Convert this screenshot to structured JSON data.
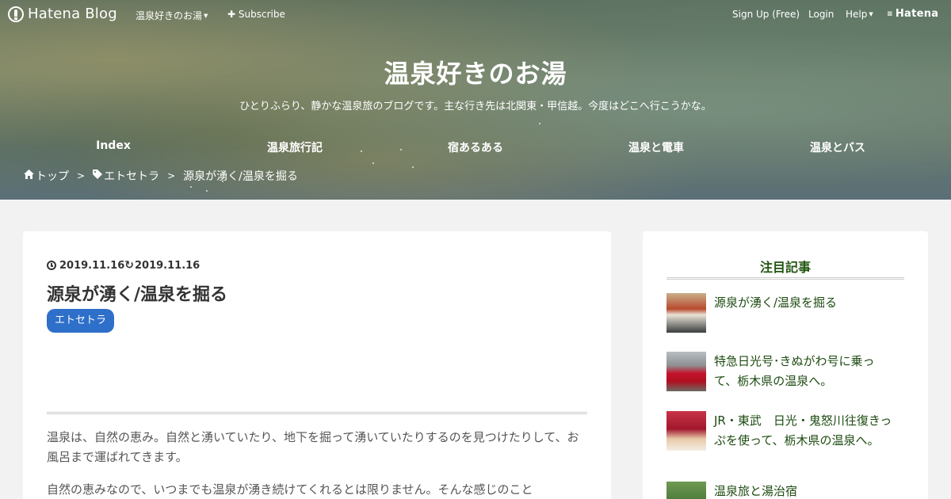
{
  "topbar": {
    "logo_text": "Hatena Blog",
    "blog_menu": "温泉好きのお湯",
    "subscribe": "Subscribe",
    "signup": "Sign Up (Free)",
    "login": "Login",
    "help": "Help",
    "hatena": "Hatena"
  },
  "header": {
    "title": "温泉好きのお湯",
    "description": "ひとりふらり、静かな温泉旅のブログです。主な行き先は北関東・甲信越。今度はどこへ行こうかな。"
  },
  "nav": {
    "items": [
      "Index",
      "温泉旅行記",
      "宿あるある",
      "温泉と電車",
      "温泉とバス"
    ]
  },
  "breadcrumb": {
    "home": "トップ",
    "category": "エトセトラ",
    "current": "源泉が湧く/温泉を掘る",
    "separator": ">"
  },
  "post": {
    "published": "2019.11.16",
    "updated": "2019.11.16",
    "title": "源泉が湧く/温泉を掘る",
    "tag": "エトセトラ",
    "paragraphs": [
      "温泉は、自然の恵み。自然と湧いていたり、地下を掘って湧いていたりするのを見つけたりして、お風呂まで運ばれてきます。",
      "自然の恵みなので、いつまでも温泉が湧き続けてくれるとは限りません。そんな感じのこと"
    ]
  },
  "sidebar": {
    "heading": "注目記事",
    "articles": [
      {
        "title": "源泉が湧く/温泉を掘る"
      },
      {
        "title": "特急日光号･きぬがわ号に乗って、栃木県の温泉へ。"
      },
      {
        "title": "JR・東武　日光・鬼怒川往復きっぷを使って、栃木県の温泉へ。"
      },
      {
        "title": "温泉旅と湯治宿"
      }
    ]
  },
  "colors": {
    "tag_bg": "#2e6fc9",
    "sidebar_link": "#1d4b11",
    "sidebar_heading": "#225511"
  }
}
